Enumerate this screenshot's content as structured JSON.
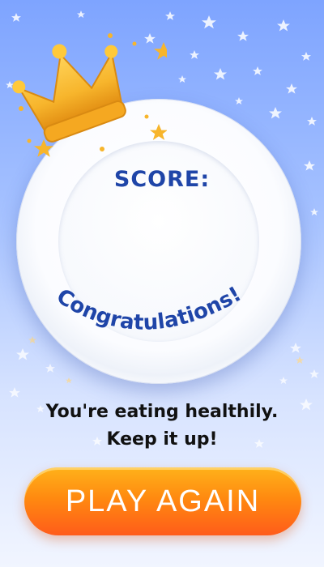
{
  "score": {
    "label": "SCORE:"
  },
  "banner": {
    "text": "Congratulations!"
  },
  "message": {
    "line1": "You're eating healthily.",
    "line2": "Keep it up!"
  },
  "actions": {
    "play_again": "PLAY AGAIN"
  },
  "theme": {
    "background_top": "#7ea4ff",
    "background_bottom": "#f1f5ff",
    "text_blue": "#1f45a8",
    "button_orange": "#ff8a10",
    "crown_gold": "#f7b52c"
  },
  "icons": {
    "crown": "crown-icon",
    "stars": "star-icon"
  }
}
